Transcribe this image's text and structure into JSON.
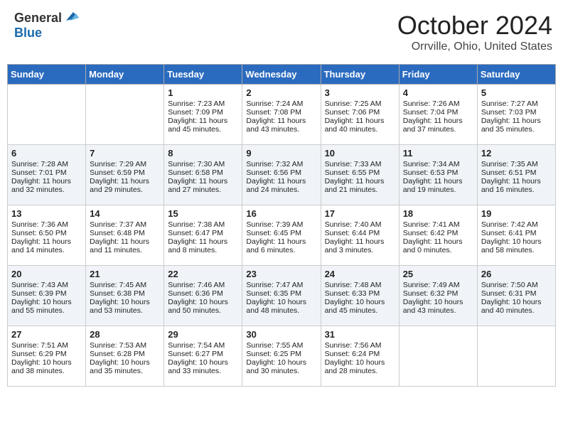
{
  "header": {
    "logo_general": "General",
    "logo_blue": "Blue",
    "month": "October 2024",
    "location": "Orrville, Ohio, United States"
  },
  "days_of_week": [
    "Sunday",
    "Monday",
    "Tuesday",
    "Wednesday",
    "Thursday",
    "Friday",
    "Saturday"
  ],
  "weeks": [
    [
      {
        "day": "",
        "sunrise": "",
        "sunset": "",
        "daylight": ""
      },
      {
        "day": "",
        "sunrise": "",
        "sunset": "",
        "daylight": ""
      },
      {
        "day": "1",
        "sunrise": "Sunrise: 7:23 AM",
        "sunset": "Sunset: 7:09 PM",
        "daylight": "Daylight: 11 hours and 45 minutes."
      },
      {
        "day": "2",
        "sunrise": "Sunrise: 7:24 AM",
        "sunset": "Sunset: 7:08 PM",
        "daylight": "Daylight: 11 hours and 43 minutes."
      },
      {
        "day": "3",
        "sunrise": "Sunrise: 7:25 AM",
        "sunset": "Sunset: 7:06 PM",
        "daylight": "Daylight: 11 hours and 40 minutes."
      },
      {
        "day": "4",
        "sunrise": "Sunrise: 7:26 AM",
        "sunset": "Sunset: 7:04 PM",
        "daylight": "Daylight: 11 hours and 37 minutes."
      },
      {
        "day": "5",
        "sunrise": "Sunrise: 7:27 AM",
        "sunset": "Sunset: 7:03 PM",
        "daylight": "Daylight: 11 hours and 35 minutes."
      }
    ],
    [
      {
        "day": "6",
        "sunrise": "Sunrise: 7:28 AM",
        "sunset": "Sunset: 7:01 PM",
        "daylight": "Daylight: 11 hours and 32 minutes."
      },
      {
        "day": "7",
        "sunrise": "Sunrise: 7:29 AM",
        "sunset": "Sunset: 6:59 PM",
        "daylight": "Daylight: 11 hours and 29 minutes."
      },
      {
        "day": "8",
        "sunrise": "Sunrise: 7:30 AM",
        "sunset": "Sunset: 6:58 PM",
        "daylight": "Daylight: 11 hours and 27 minutes."
      },
      {
        "day": "9",
        "sunrise": "Sunrise: 7:32 AM",
        "sunset": "Sunset: 6:56 PM",
        "daylight": "Daylight: 11 hours and 24 minutes."
      },
      {
        "day": "10",
        "sunrise": "Sunrise: 7:33 AM",
        "sunset": "Sunset: 6:55 PM",
        "daylight": "Daylight: 11 hours and 21 minutes."
      },
      {
        "day": "11",
        "sunrise": "Sunrise: 7:34 AM",
        "sunset": "Sunset: 6:53 PM",
        "daylight": "Daylight: 11 hours and 19 minutes."
      },
      {
        "day": "12",
        "sunrise": "Sunrise: 7:35 AM",
        "sunset": "Sunset: 6:51 PM",
        "daylight": "Daylight: 11 hours and 16 minutes."
      }
    ],
    [
      {
        "day": "13",
        "sunrise": "Sunrise: 7:36 AM",
        "sunset": "Sunset: 6:50 PM",
        "daylight": "Daylight: 11 hours and 14 minutes."
      },
      {
        "day": "14",
        "sunrise": "Sunrise: 7:37 AM",
        "sunset": "Sunset: 6:48 PM",
        "daylight": "Daylight: 11 hours and 11 minutes."
      },
      {
        "day": "15",
        "sunrise": "Sunrise: 7:38 AM",
        "sunset": "Sunset: 6:47 PM",
        "daylight": "Daylight: 11 hours and 8 minutes."
      },
      {
        "day": "16",
        "sunrise": "Sunrise: 7:39 AM",
        "sunset": "Sunset: 6:45 PM",
        "daylight": "Daylight: 11 hours and 6 minutes."
      },
      {
        "day": "17",
        "sunrise": "Sunrise: 7:40 AM",
        "sunset": "Sunset: 6:44 PM",
        "daylight": "Daylight: 11 hours and 3 minutes."
      },
      {
        "day": "18",
        "sunrise": "Sunrise: 7:41 AM",
        "sunset": "Sunset: 6:42 PM",
        "daylight": "Daylight: 11 hours and 0 minutes."
      },
      {
        "day": "19",
        "sunrise": "Sunrise: 7:42 AM",
        "sunset": "Sunset: 6:41 PM",
        "daylight": "Daylight: 10 hours and 58 minutes."
      }
    ],
    [
      {
        "day": "20",
        "sunrise": "Sunrise: 7:43 AM",
        "sunset": "Sunset: 6:39 PM",
        "daylight": "Daylight: 10 hours and 55 minutes."
      },
      {
        "day": "21",
        "sunrise": "Sunrise: 7:45 AM",
        "sunset": "Sunset: 6:38 PM",
        "daylight": "Daylight: 10 hours and 53 minutes."
      },
      {
        "day": "22",
        "sunrise": "Sunrise: 7:46 AM",
        "sunset": "Sunset: 6:36 PM",
        "daylight": "Daylight: 10 hours and 50 minutes."
      },
      {
        "day": "23",
        "sunrise": "Sunrise: 7:47 AM",
        "sunset": "Sunset: 6:35 PM",
        "daylight": "Daylight: 10 hours and 48 minutes."
      },
      {
        "day": "24",
        "sunrise": "Sunrise: 7:48 AM",
        "sunset": "Sunset: 6:33 PM",
        "daylight": "Daylight: 10 hours and 45 minutes."
      },
      {
        "day": "25",
        "sunrise": "Sunrise: 7:49 AM",
        "sunset": "Sunset: 6:32 PM",
        "daylight": "Daylight: 10 hours and 43 minutes."
      },
      {
        "day": "26",
        "sunrise": "Sunrise: 7:50 AM",
        "sunset": "Sunset: 6:31 PM",
        "daylight": "Daylight: 10 hours and 40 minutes."
      }
    ],
    [
      {
        "day": "27",
        "sunrise": "Sunrise: 7:51 AM",
        "sunset": "Sunset: 6:29 PM",
        "daylight": "Daylight: 10 hours and 38 minutes."
      },
      {
        "day": "28",
        "sunrise": "Sunrise: 7:53 AM",
        "sunset": "Sunset: 6:28 PM",
        "daylight": "Daylight: 10 hours and 35 minutes."
      },
      {
        "day": "29",
        "sunrise": "Sunrise: 7:54 AM",
        "sunset": "Sunset: 6:27 PM",
        "daylight": "Daylight: 10 hours and 33 minutes."
      },
      {
        "day": "30",
        "sunrise": "Sunrise: 7:55 AM",
        "sunset": "Sunset: 6:25 PM",
        "daylight": "Daylight: 10 hours and 30 minutes."
      },
      {
        "day": "31",
        "sunrise": "Sunrise: 7:56 AM",
        "sunset": "Sunset: 6:24 PM",
        "daylight": "Daylight: 10 hours and 28 minutes."
      },
      {
        "day": "",
        "sunrise": "",
        "sunset": "",
        "daylight": ""
      },
      {
        "day": "",
        "sunrise": "",
        "sunset": "",
        "daylight": ""
      }
    ]
  ]
}
